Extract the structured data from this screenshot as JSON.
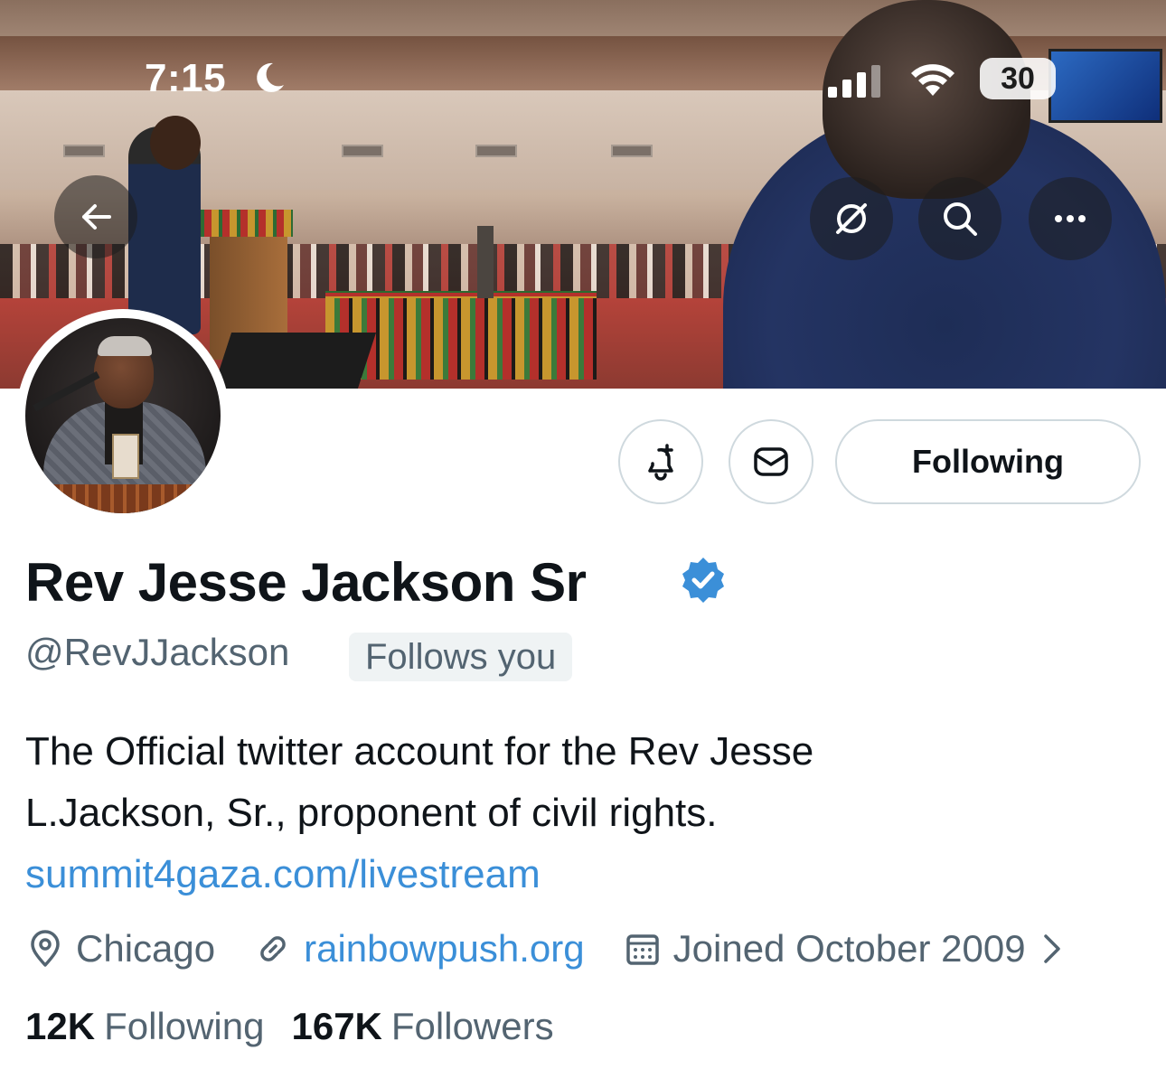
{
  "status_bar": {
    "time": "7:15",
    "battery": "30"
  },
  "profile": {
    "display_name": "Rev Jesse Jackson Sr",
    "handle": "@RevJJackson",
    "follows_you": "Follows you",
    "bio_line1": "The Official twitter account for the Rev Jesse",
    "bio_line2": "L.Jackson, Sr., proponent of civil rights.",
    "bio_link": "summit4gaza.com/livestream",
    "location": "Chicago",
    "website": "rainbowpush.org",
    "joined": "Joined October 2009",
    "following_count": "12K",
    "following_label": "Following",
    "followers_count": "167K",
    "followers_label": "Followers"
  },
  "actions": {
    "following_button": "Following"
  },
  "icons": {
    "back": "arrow-left-icon",
    "grok": "grok-icon",
    "search": "search-icon",
    "more": "more-icon",
    "notify": "bell-plus-icon",
    "message": "envelope-icon",
    "verified": "verified-badge-icon",
    "location": "location-pin-icon",
    "link": "link-icon",
    "calendar": "calendar-icon"
  },
  "colors": {
    "text": "#0f1419",
    "secondary": "#536471",
    "link": "#3b8fd8",
    "verified": "#3b8fd8",
    "border": "#cfd9de"
  }
}
